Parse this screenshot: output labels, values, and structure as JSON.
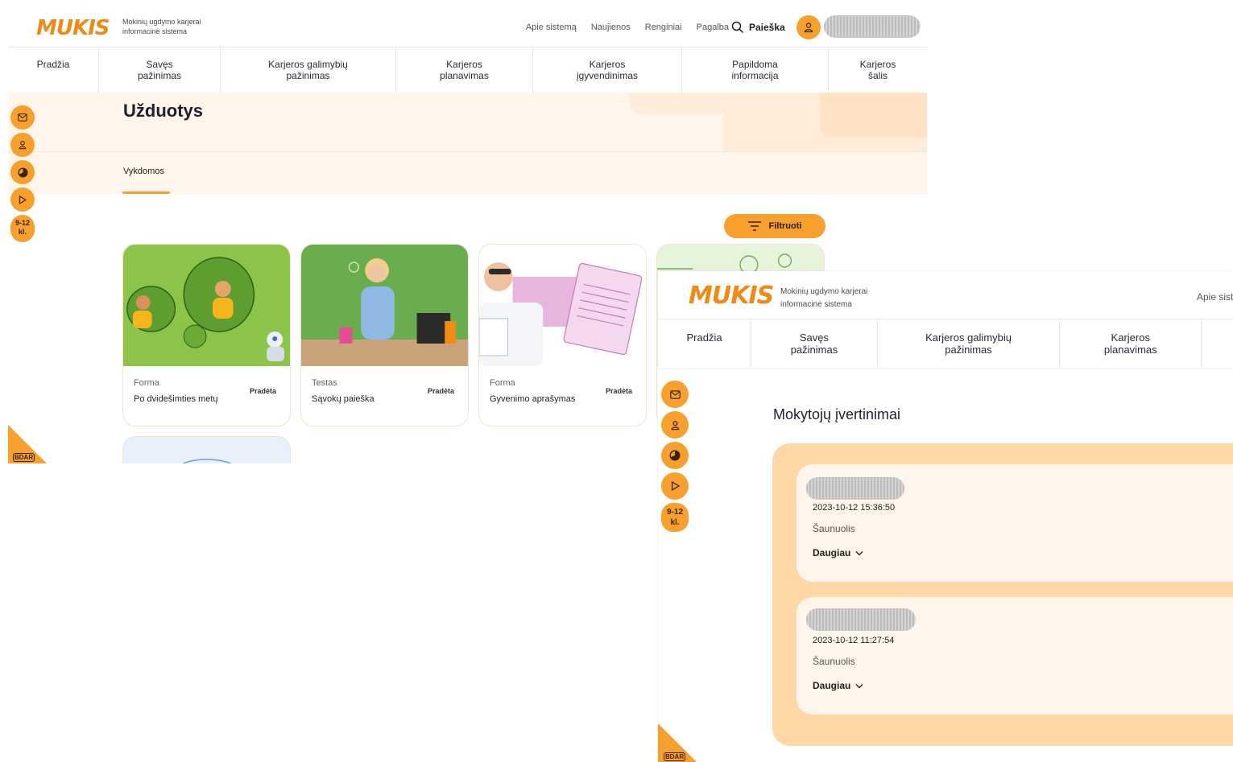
{
  "brand": {
    "logo": "MUKIS",
    "subtitle_line1": "Mokinių ugdymo karjerai",
    "subtitle_line2": "informacinė sistema",
    "accent_color": "#f7a02e"
  },
  "top_nav": {
    "links": [
      "Apie sistemą",
      "Naujienos",
      "Renginiai",
      "Pagalba"
    ],
    "search_label": "Paieška",
    "truncated_link": "Apie sist"
  },
  "main_menu": [
    {
      "line1": "Pradžia",
      "line2": ""
    },
    {
      "line1": "Savęs",
      "line2": "pažinimas"
    },
    {
      "line1": "Karjeros galimybių",
      "line2": "pažinimas"
    },
    {
      "line1": "Karjeros",
      "line2": "planavimas"
    },
    {
      "line1": "Karjeros",
      "line2": "įgyvendinimas"
    },
    {
      "line1": "Papildoma",
      "line2": "informacija"
    },
    {
      "line1": "Karjeros",
      "line2": "šalis"
    }
  ],
  "rail": {
    "icons": [
      "mail-icon",
      "user-icon",
      "chart-icon",
      "play-icon"
    ],
    "grade_line1": "9-12",
    "grade_line2": "kl."
  },
  "bdar_label": "BDAR",
  "tasks_page": {
    "title": "Užduotys",
    "tab": "Vykdomos",
    "filter_label": "Filtruoti",
    "cards": [
      {
        "type": "Forma",
        "title": "Po dvidešimties metų",
        "status": "Pradėta"
      },
      {
        "type": "Testas",
        "title": "Sąvokų paieška",
        "status": "Pradėta"
      },
      {
        "type": "Forma",
        "title": "Gyvenimo aprašymas",
        "status": "Pradėta"
      }
    ]
  },
  "evaluations_page": {
    "title": "Mokytojų įvertinimai",
    "items": [
      {
        "date": "2023-10-12 15:36:50",
        "text": "Šaunuolis",
        "more": "Daugiau"
      },
      {
        "date": "2023-10-12 11:27:54",
        "text": "Šaunuolis",
        "more": "Daugiau"
      }
    ]
  }
}
